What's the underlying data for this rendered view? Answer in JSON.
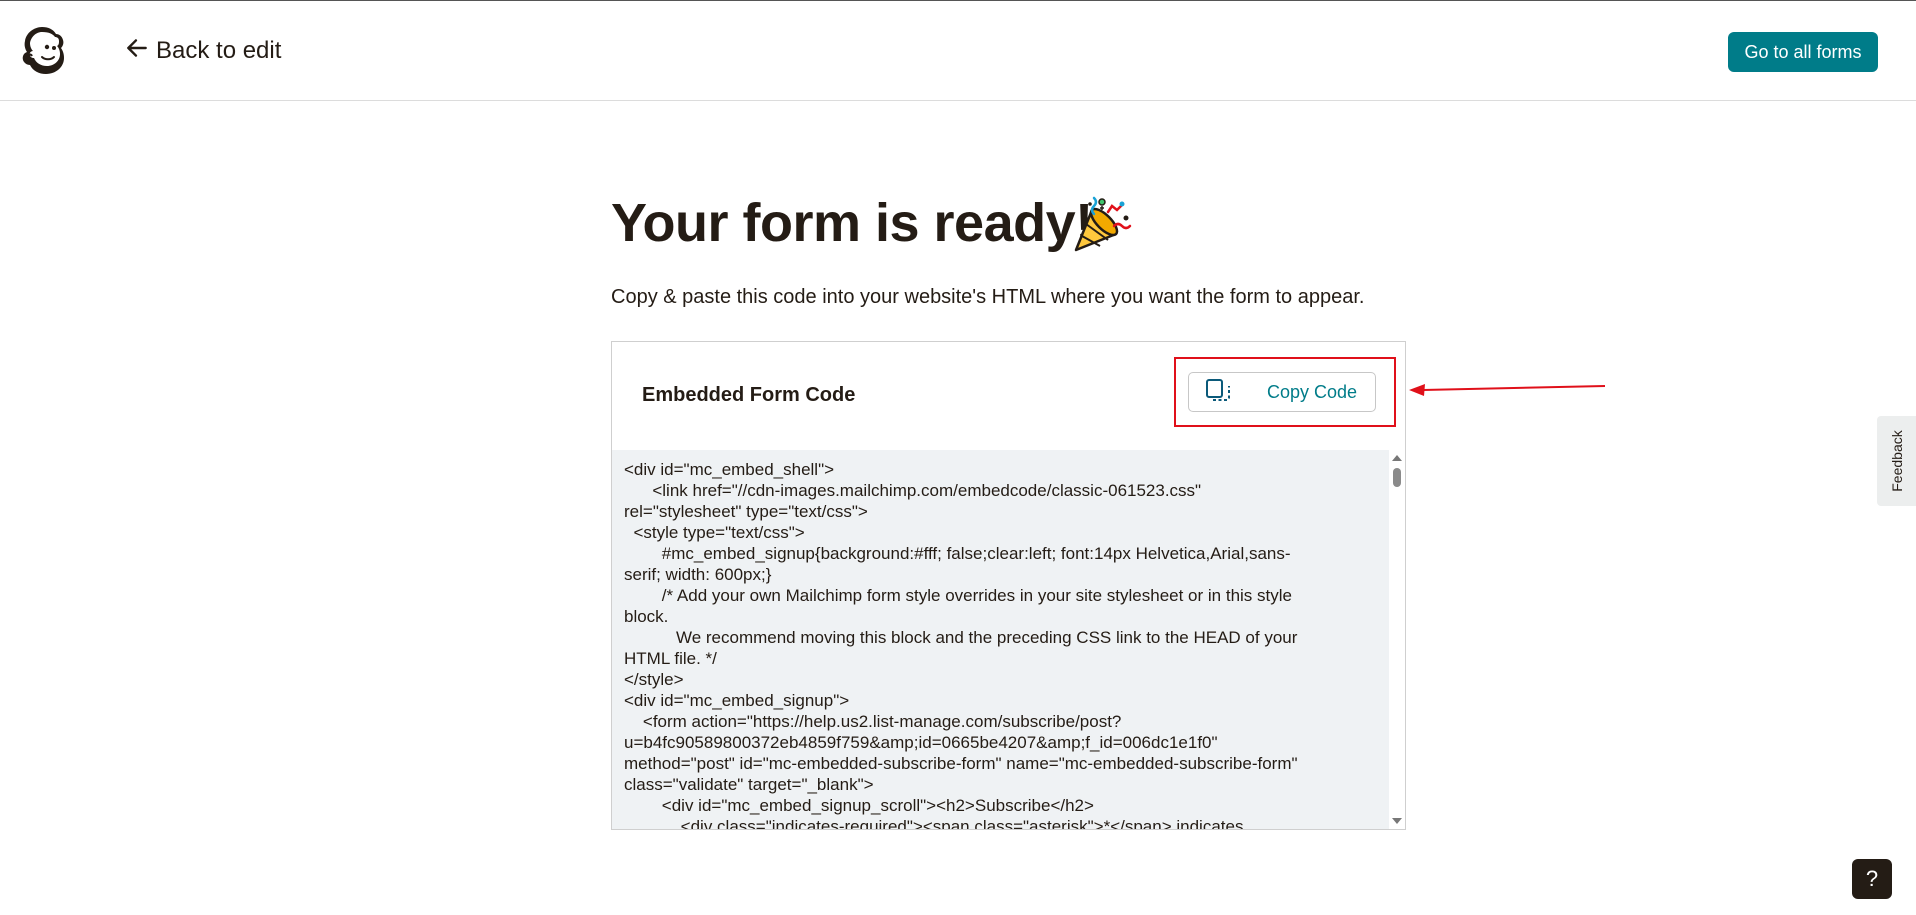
{
  "header": {
    "back_label": "Back to edit",
    "all_forms_label": "Go to all forms"
  },
  "main": {
    "title": "Your form is ready!",
    "subtitle": "Copy & paste this code into your website's HTML where you want the form to appear."
  },
  "code_card": {
    "title": "Embedded Form Code",
    "copy_label": "Copy Code",
    "code_lines": [
      "<div id=\"mc_embed_shell\">",
      "      <link href=\"//cdn-images.mailchimp.com/embedcode/classic-061523.css\"",
      "rel=\"stylesheet\" type=\"text/css\">",
      "  <style type=\"text/css\">",
      "        #mc_embed_signup{background:#fff; false;clear:left; font:14px Helvetica,Arial,sans-",
      "serif; width: 600px;}",
      "        /* Add your own Mailchimp form style overrides in your site stylesheet or in this style",
      "block.",
      "           We recommend moving this block and the preceding CSS link to the HEAD of your",
      "HTML file. */",
      "</style>",
      "<div id=\"mc_embed_signup\">",
      "    <form action=\"https://help.us2.list-manage.com/subscribe/post?",
      "u=b4fc90589800372eb4859f759&amp;id=0665be4207&amp;f_id=006dc1e1f0\"",
      "method=\"post\" id=\"mc-embedded-subscribe-form\" name=\"mc-embedded-subscribe-form\"",
      "class=\"validate\" target=\"_blank\">",
      "        <div id=\"mc_embed_signup_scroll\"><h2>Subscribe</h2>",
      "            <div class=\"indicates-required\"><span class=\"asterisk\">*</span> indicates"
    ]
  },
  "feedback_label": "Feedback",
  "help_label": "?",
  "colors": {
    "brand_teal": "#007c89",
    "annotation_red": "#e0101a",
    "code_bg": "#eff2f4",
    "text": "#241c15"
  }
}
